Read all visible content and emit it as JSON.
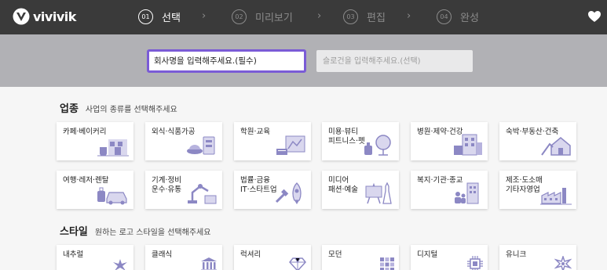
{
  "header": {
    "logo_text": "vivivik",
    "steps": [
      {
        "num": "01",
        "label": "선택",
        "active": true
      },
      {
        "num": "02",
        "label": "미리보기",
        "active": false
      },
      {
        "num": "03",
        "label": "편집",
        "active": false
      },
      {
        "num": "04",
        "label": "완성",
        "active": false
      }
    ],
    "chevron": "›",
    "favorite_icon": "heart-icon"
  },
  "inputs": {
    "company_placeholder": "회사명을 입력해주세요.(필수)",
    "slogan_placeholder": "슬로건을 입력해주세요.(선택)"
  },
  "industry": {
    "title": "업종",
    "subtitle": "사업의 종류를 선택해주세요",
    "items": [
      {
        "label": "카페·베이커리",
        "icon": "cafe-icon"
      },
      {
        "label": "외식·식품가공",
        "icon": "food-icon"
      },
      {
        "label": "학원·교육",
        "icon": "education-icon"
      },
      {
        "label": "미용·뷰티\n피트니스·펫",
        "icon": "beauty-icon"
      },
      {
        "label": "병원·제약·건강",
        "icon": "hospital-icon"
      },
      {
        "label": "숙박·부동산·건축",
        "icon": "house-icon"
      },
      {
        "label": "여행·레저·렌탈",
        "icon": "travel-icon"
      },
      {
        "label": "기계·정비\n운수·유통",
        "icon": "machine-icon"
      },
      {
        "label": "법률·금융\nIT·스타트업",
        "icon": "rocket-icon"
      },
      {
        "label": "미디어\n패션·예술",
        "icon": "media-icon"
      },
      {
        "label": "복지·기관·종교",
        "icon": "welfare-icon"
      },
      {
        "label": "제조·도소매\n기타자영업",
        "icon": "factory-icon"
      }
    ]
  },
  "style": {
    "title": "스타일",
    "subtitle": "원하는 로고 스타일을 선택해주세요",
    "items": [
      {
        "label": "내추럴",
        "icon": "leaf-icon"
      },
      {
        "label": "클래식",
        "icon": "columns-icon"
      },
      {
        "label": "럭셔리",
        "icon": "diamond-icon"
      },
      {
        "label": "모던",
        "icon": "grid-icon"
      },
      {
        "label": "디지털",
        "icon": "chip-icon"
      },
      {
        "label": "유니크",
        "icon": "unique-icon"
      }
    ]
  },
  "colors": {
    "topbar": "#3a3a3a",
    "band": "#b1b1b5",
    "accent": "#7a5bd6",
    "icon": "#8c88c4"
  }
}
